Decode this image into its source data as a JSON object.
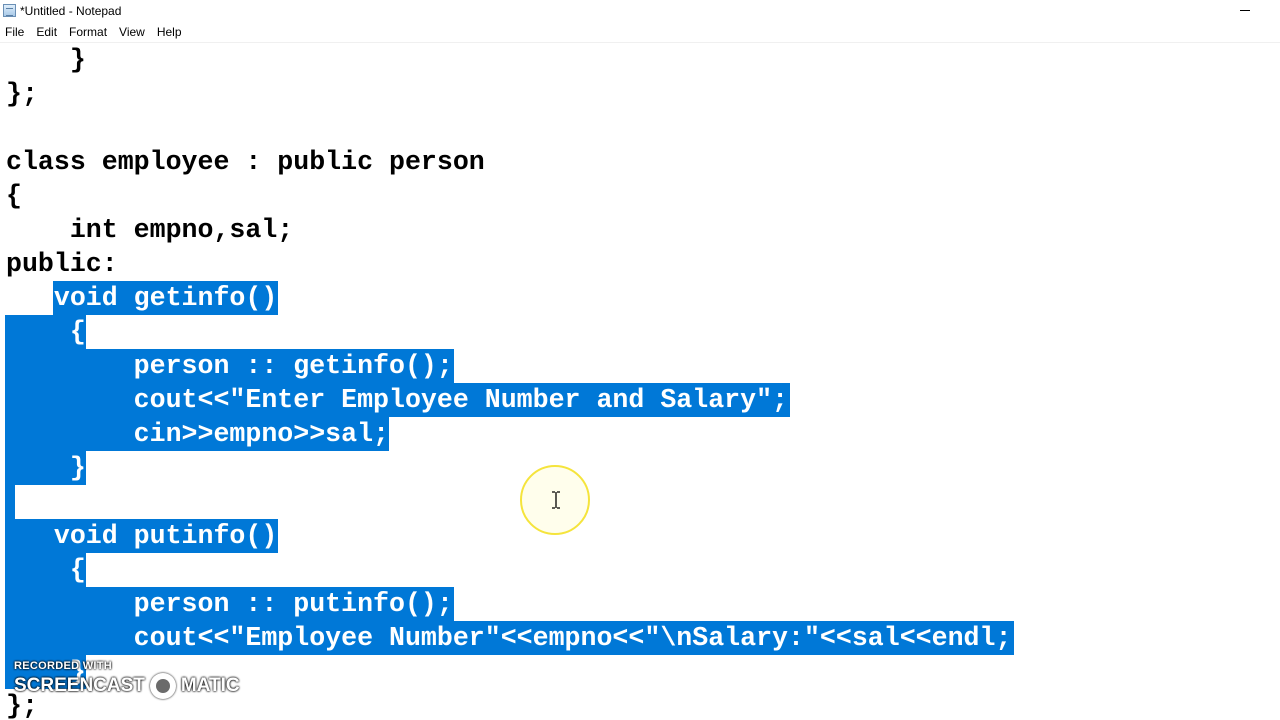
{
  "window": {
    "title": "*Untitled - Notepad"
  },
  "menu": [
    "File",
    "Edit",
    "Format",
    "View",
    "Help"
  ],
  "editor": {
    "lines": [
      "    }",
      "};",
      "",
      "class employee : public person",
      "{",
      "    int empno,sal;",
      "public:",
      "   void getinfo()",
      "    {",
      "        person :: getinfo();",
      "        cout<<\"Enter Employee Number and Salary\";",
      "        cin>>empno>>sal;",
      "    }",
      "",
      "   void putinfo()",
      "    {",
      "        person :: putinfo();",
      "        cout<<\"Employee Number\"<<empno<<\"\\nSalary:\"<<sal<<endl;",
      "    }",
      "};"
    ],
    "selection": {
      "from_line": 7,
      "to_line": 18
    },
    "selection_color": "#0078d7"
  },
  "watermark": {
    "small": "RECORDED WITH",
    "left": "SCREENCAST",
    "right": "MATIC"
  }
}
